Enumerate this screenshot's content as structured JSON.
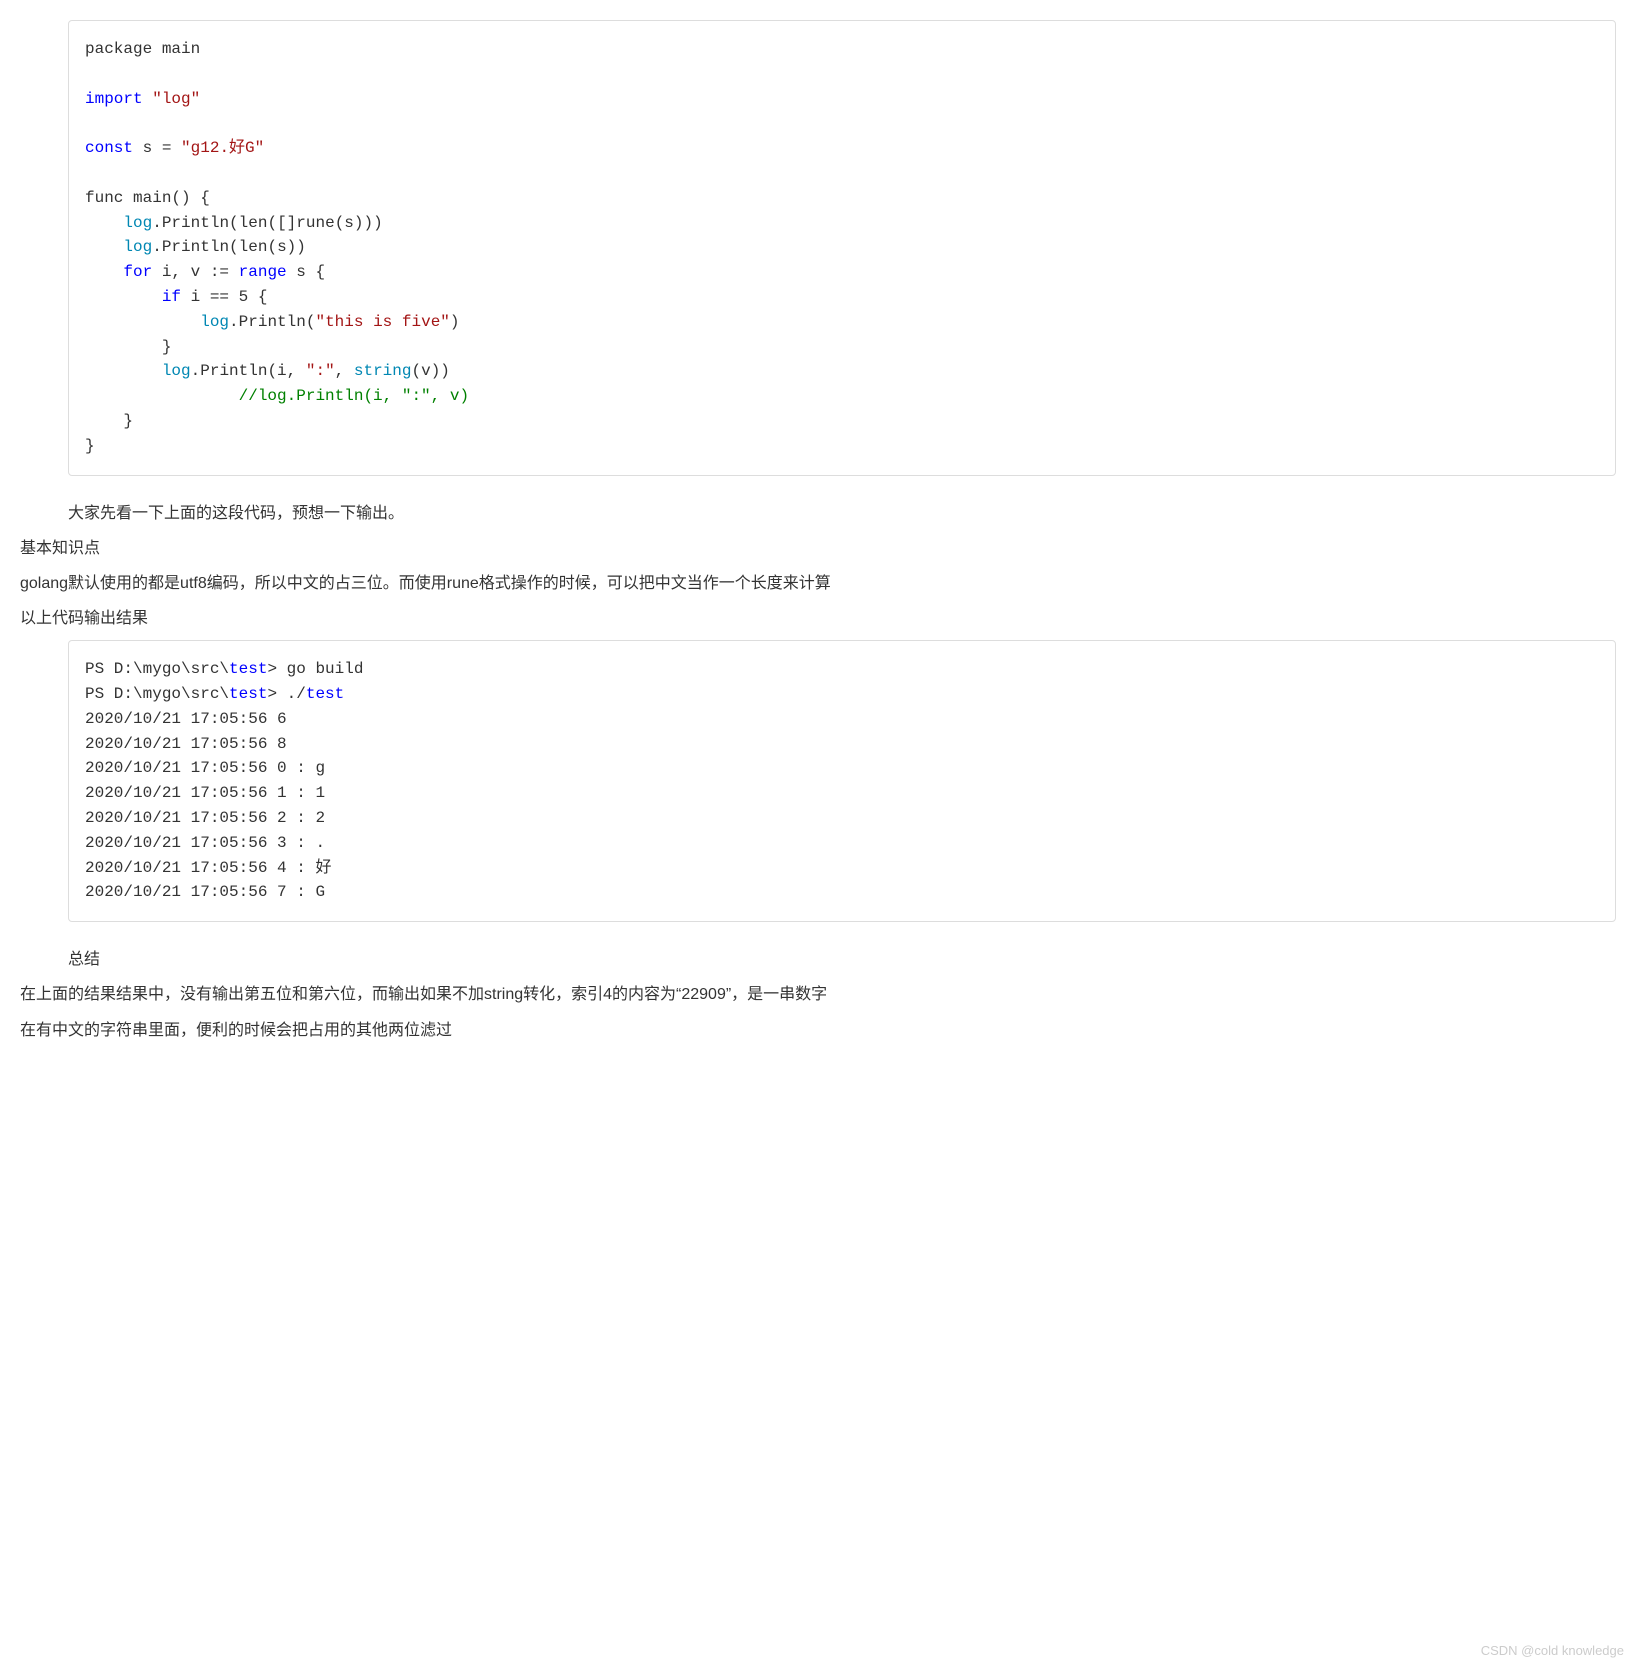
{
  "code1": {
    "tokens": [
      {
        "text": "package",
        "cls": ""
      },
      {
        "text": " main\n\n",
        "cls": ""
      },
      {
        "text": "import",
        "cls": "kw-blue"
      },
      {
        "text": " ",
        "cls": ""
      },
      {
        "text": "\"log\"",
        "cls": "str-red"
      },
      {
        "text": "\n\n",
        "cls": ""
      },
      {
        "text": "const",
        "cls": "kw-blue"
      },
      {
        "text": " s = ",
        "cls": ""
      },
      {
        "text": "\"g12.好G\"",
        "cls": "str-red"
      },
      {
        "text": "\n\n",
        "cls": ""
      },
      {
        "text": "func",
        "cls": ""
      },
      {
        "text": " ",
        "cls": ""
      },
      {
        "text": "main",
        "cls": ""
      },
      {
        "text": "() {\n",
        "cls": ""
      },
      {
        "text": "    ",
        "cls": ""
      },
      {
        "text": "log",
        "cls": "kw-cyan"
      },
      {
        "text": ".",
        "cls": ""
      },
      {
        "text": "Println",
        "cls": ""
      },
      {
        "text": "(",
        "cls": ""
      },
      {
        "text": "len",
        "cls": ""
      },
      {
        "text": "([]",
        "cls": ""
      },
      {
        "text": "rune",
        "cls": ""
      },
      {
        "text": "(s)))\n",
        "cls": ""
      },
      {
        "text": "    ",
        "cls": ""
      },
      {
        "text": "log",
        "cls": "kw-cyan"
      },
      {
        "text": ".",
        "cls": ""
      },
      {
        "text": "Println",
        "cls": ""
      },
      {
        "text": "(",
        "cls": ""
      },
      {
        "text": "len",
        "cls": ""
      },
      {
        "text": "(s))\n",
        "cls": ""
      },
      {
        "text": "    ",
        "cls": ""
      },
      {
        "text": "for",
        "cls": "kw-blue"
      },
      {
        "text": " i, v := ",
        "cls": ""
      },
      {
        "text": "range",
        "cls": "kw-blue"
      },
      {
        "text": " s {\n",
        "cls": ""
      },
      {
        "text": "        ",
        "cls": ""
      },
      {
        "text": "if",
        "cls": "kw-blue"
      },
      {
        "text": " i == ",
        "cls": ""
      },
      {
        "text": "5",
        "cls": ""
      },
      {
        "text": " {\n",
        "cls": ""
      },
      {
        "text": "            ",
        "cls": ""
      },
      {
        "text": "log",
        "cls": "kw-cyan"
      },
      {
        "text": ".",
        "cls": ""
      },
      {
        "text": "Println",
        "cls": ""
      },
      {
        "text": "(",
        "cls": ""
      },
      {
        "text": "\"this is five\"",
        "cls": "str-red"
      },
      {
        "text": ")\n",
        "cls": ""
      },
      {
        "text": "        }\n",
        "cls": ""
      },
      {
        "text": "        ",
        "cls": ""
      },
      {
        "text": "log",
        "cls": "kw-cyan"
      },
      {
        "text": ".",
        "cls": ""
      },
      {
        "text": "Println",
        "cls": ""
      },
      {
        "text": "(i, ",
        "cls": ""
      },
      {
        "text": "\":\"",
        "cls": "str-red"
      },
      {
        "text": ", ",
        "cls": ""
      },
      {
        "text": "string",
        "cls": "kw-cyan"
      },
      {
        "text": "(v))\n",
        "cls": ""
      },
      {
        "text": "                ",
        "cls": ""
      },
      {
        "text": "//log.Println(i, \":\", v)",
        "cls": "comment-green"
      },
      {
        "text": "\n",
        "cls": ""
      },
      {
        "text": "    }\n",
        "cls": ""
      },
      {
        "text": "}\n",
        "cls": ""
      }
    ]
  },
  "paragraphs": {
    "p1": "大家先看一下上面的这段代码，预想一下输出。",
    "p2": "基本知识点",
    "p3": "golang默认使用的都是utf8编码，所以中文的占三位。而使用rune格式操作的时候，可以把中文当作一个长度来计算",
    "p4": "以上代码输出结果",
    "p5": "总结",
    "p6": "在上面的结果结果中，没有输出第五位和第六位，而输出如果不加string转化，索引4的内容为“22909”，是一串数字",
    "p7": "在有中文的字符串里面，便利的时候会把占用的其他两位滤过"
  },
  "code2": {
    "tokens": [
      {
        "text": "PS D:\\mygo\\src\\",
        "cls": ""
      },
      {
        "text": "test",
        "cls": "kw-blue"
      },
      {
        "text": "> go build\n",
        "cls": ""
      },
      {
        "text": "PS D:\\mygo\\src\\",
        "cls": ""
      },
      {
        "text": "test",
        "cls": "kw-blue"
      },
      {
        "text": "> ./",
        "cls": ""
      },
      {
        "text": "test",
        "cls": "kw-blue"
      },
      {
        "text": "\n",
        "cls": ""
      },
      {
        "text": "2020/10/21 17:05:56 6\n",
        "cls": ""
      },
      {
        "text": "2020/10/21 17:05:56 8\n",
        "cls": ""
      },
      {
        "text": "2020/10/21 17:05:56 0 : g\n",
        "cls": ""
      },
      {
        "text": "2020/10/21 17:05:56 1 : 1\n",
        "cls": ""
      },
      {
        "text": "2020/10/21 17:05:56 2 : 2\n",
        "cls": ""
      },
      {
        "text": "2020/10/21 17:05:56 3 : .\n",
        "cls": ""
      },
      {
        "text": "2020/10/21 17:05:56 4 : 好\n",
        "cls": ""
      },
      {
        "text": "2020/10/21 17:05:56 7 : G",
        "cls": ""
      }
    ]
  },
  "watermark": "CSDN @cold knowledge"
}
